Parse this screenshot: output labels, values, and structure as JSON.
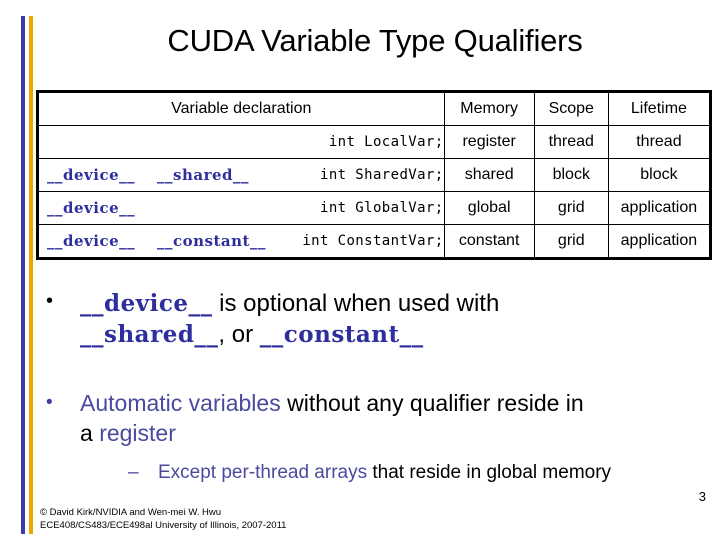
{
  "slide": {
    "title": "CUDA Variable Type Qualifiers",
    "page_number": "3",
    "accent_blue": "#3b3bb0",
    "accent_orange": "#f0a400",
    "keyword_color": "#2e2e9e"
  },
  "table": {
    "headers": {
      "declaration": "Variable declaration",
      "memory": "Memory",
      "scope": "Scope",
      "lifetime": "Lifetime"
    },
    "rows": [
      {
        "qualifier1": "",
        "qualifier2": "",
        "declaration": "int LocalVar;",
        "memory": "register",
        "scope": "thread",
        "lifetime": "thread"
      },
      {
        "qualifier1": "__device__",
        "qualifier2": "__shared__",
        "declaration": "int SharedVar;",
        "memory": "shared",
        "scope": "block",
        "lifetime": "block"
      },
      {
        "qualifier1": "__device__",
        "qualifier2": "",
        "declaration": "int GlobalVar;",
        "memory": "global",
        "scope": "grid",
        "lifetime": "application"
      },
      {
        "qualifier1": "__device__",
        "qualifier2": "__constant__",
        "declaration": "int ConstantVar;",
        "memory": "constant",
        "scope": "grid",
        "lifetime": "application"
      }
    ]
  },
  "bullets": {
    "marker_dot": "•",
    "marker_dash": "–",
    "bullet1": {
      "kw_device": "__device__",
      "text_middle": " is optional when used with",
      "kw_shared": "__shared__",
      "text_comma": ", or ",
      "kw_constant": "__constant__"
    },
    "bullet2": {
      "accent1": "Automatic variables",
      "text1": " without any qualifier reside in",
      "text2": "a ",
      "accent2": "register"
    },
    "subbullet": {
      "accent": "Except per-thread arrays",
      "text": " that reside in global memory"
    }
  },
  "footer": {
    "line1": "© David Kirk/NVIDIA and Wen-mei W. Hwu",
    "line2": "ECE408/CS483/ECE498al University of Illinois, 2007-2011"
  }
}
